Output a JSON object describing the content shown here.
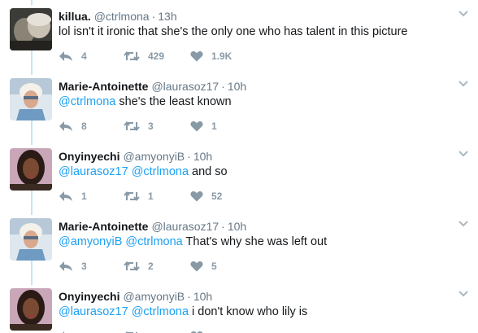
{
  "colors": {
    "link": "#1da1f2",
    "meta": "#657786",
    "action": "#8899a6",
    "thread_line": "#c4e4f5"
  },
  "icons": {
    "reply": "reply-arrow-icon",
    "retweet": "retweet-arrows-icon",
    "like": "heart-icon",
    "more": "chevron-down-icon"
  },
  "tweets": [
    {
      "name": "killua.",
      "handle": "@ctrlmona",
      "time": "13h",
      "text": [
        {
          "t": "lol isn't it ironic that she's the only one who has talent in this picture",
          "mention": false
        }
      ],
      "replies": "4",
      "retweets": "429",
      "likes": "1.9K"
    },
    {
      "name": "Marie-Antoinette",
      "handle": "@laurasoz17",
      "time": "10h",
      "text": [
        {
          "t": "@ctrlmona",
          "mention": true
        },
        {
          "t": " she's the least known",
          "mention": false
        }
      ],
      "replies": "8",
      "retweets": "3",
      "likes": "1"
    },
    {
      "name": "Onyinyechi",
      "handle": "@amyonyiB",
      "time": "10h",
      "text": [
        {
          "t": "@laurasoz17",
          "mention": true
        },
        {
          "t": " ",
          "mention": false
        },
        {
          "t": "@ctrlmona",
          "mention": true
        },
        {
          "t": " and so",
          "mention": false
        }
      ],
      "replies": "1",
      "retweets": "1",
      "likes": "52"
    },
    {
      "name": "Marie-Antoinette",
      "handle": "@laurasoz17",
      "time": "10h",
      "text": [
        {
          "t": "@amyonyiB",
          "mention": true
        },
        {
          "t": " ",
          "mention": false
        },
        {
          "t": "@ctrlmona",
          "mention": true
        },
        {
          "t": " That's why she was left out",
          "mention": false
        }
      ],
      "replies": "3",
      "retweets": "2",
      "likes": "5"
    },
    {
      "name": "Onyinyechi",
      "handle": "@amyonyiB",
      "time": "10h",
      "text": [
        {
          "t": "@laurasoz17",
          "mention": true
        },
        {
          "t": " ",
          "mention": false
        },
        {
          "t": "@ctrlmona",
          "mention": true
        },
        {
          "t": " i don't know who lily is",
          "mention": false
        }
      ],
      "replies": "",
      "retweets": "",
      "likes": ""
    }
  ]
}
